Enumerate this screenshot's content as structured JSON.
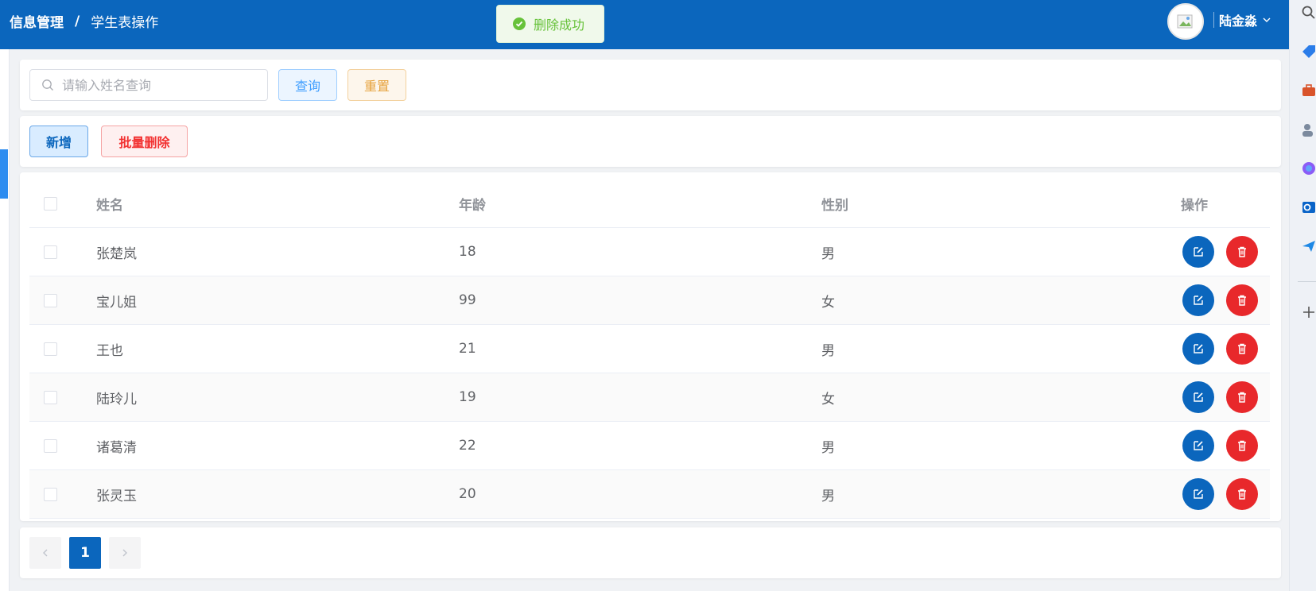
{
  "header": {
    "breadcrumb_root": "信息管理",
    "breadcrumb_sep": "/",
    "breadcrumb_current": "学生表操作",
    "username": "陆金淼"
  },
  "toast": {
    "message": "删除成功",
    "type": "success"
  },
  "search": {
    "placeholder": "请输入姓名查询",
    "value": ""
  },
  "buttons": {
    "query": "查询",
    "reset": "重置",
    "add": "新增",
    "batch_delete": "批量删除"
  },
  "table": {
    "columns": {
      "name": "姓名",
      "age": "年龄",
      "gender": "性别",
      "ops": "操作"
    },
    "rows": [
      {
        "name": "张楚岚",
        "age": "18",
        "gender": "男"
      },
      {
        "name": "宝儿姐",
        "age": "99",
        "gender": "女"
      },
      {
        "name": "王也",
        "age": "21",
        "gender": "男"
      },
      {
        "name": "陆玲儿",
        "age": "19",
        "gender": "女"
      },
      {
        "name": "诸葛清",
        "age": "22",
        "gender": "男"
      },
      {
        "name": "张灵玉",
        "age": "20",
        "gender": "男"
      }
    ]
  },
  "pagination": {
    "current_page": "1"
  },
  "colors": {
    "primary": "#0b66bd",
    "danger": "#e8282b",
    "success": "#67c23a",
    "warning": "#e6a23c"
  }
}
